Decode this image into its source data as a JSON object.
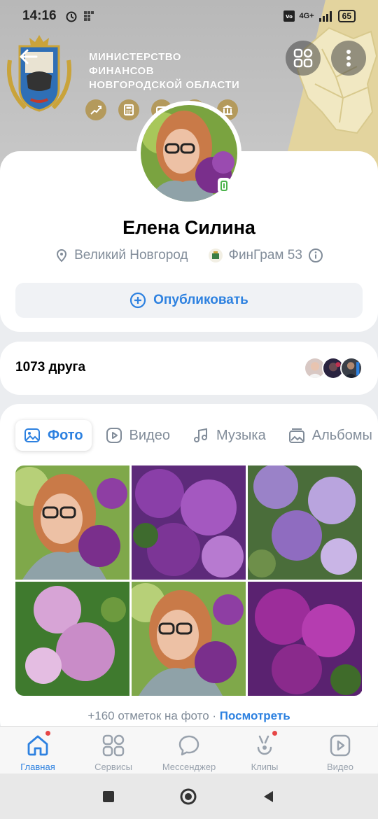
{
  "status_bar": {
    "time": "14:16",
    "network": "4G+",
    "battery": "65"
  },
  "cover": {
    "ministry_lines": [
      "МИНИСТЕРСТВО",
      "ФИНАНСОВ",
      "НОВГОРОДСКОЙ ОБЛАСТИ"
    ],
    "icons": [
      "chart-icon",
      "calculator-icon",
      "wallet-icon",
      "coins-icon",
      "bank-icon"
    ]
  },
  "profile": {
    "name": "Елена Силина",
    "city": "Великий Новгород",
    "community": "ФинГрам 53",
    "publish_label": "Опубликовать"
  },
  "friends": {
    "count_label": "1073 друга"
  },
  "media": {
    "tabs": [
      {
        "label": "Фото",
        "icon": "photo-icon"
      },
      {
        "label": "Видео",
        "icon": "video-icon"
      },
      {
        "label": "Музыка",
        "icon": "music-icon"
      },
      {
        "label": "Альбомы",
        "icon": "album-icon"
      }
    ],
    "tags_text": "+160 отметок на фото · ",
    "tags_link": "Посмотреть"
  },
  "tabbar": [
    {
      "label": "Главная",
      "icon": "home-icon"
    },
    {
      "label": "Сервисы",
      "icon": "services-icon"
    },
    {
      "label": "Мессенджер",
      "icon": "messenger-icon"
    },
    {
      "label": "Клипы",
      "icon": "clips-icon"
    },
    {
      "label": "Видео",
      "icon": "video-icon"
    }
  ],
  "colors": {
    "accent": "#2d81e0",
    "muted": "#818c99",
    "online": "#4bb34b",
    "badge": "#e64646"
  }
}
